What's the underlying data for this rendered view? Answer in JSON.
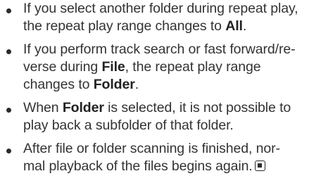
{
  "bullets": [
    {
      "lines": [
        [
          "If you select another folder during repeat play,"
        ],
        [
          "the repeat play range changes to ",
          "All",
          "."
        ]
      ]
    },
    {
      "lines": [
        [
          "If you perform track search or fast forward/re-"
        ],
        [
          "verse during ",
          "File",
          ", the repeat play range"
        ],
        [
          "changes to ",
          "Folder",
          "."
        ]
      ]
    },
    {
      "lines": [
        [
          "When ",
          "Folder",
          " is selected, it is not possible to"
        ],
        [
          "play back a subfolder of that folder."
        ]
      ]
    },
    {
      "lines": [
        [
          "After file or folder scanning is finished, nor-"
        ],
        [
          "mal playback of the files begins again."
        ]
      ]
    }
  ],
  "end_mark": "end-of-section-icon"
}
